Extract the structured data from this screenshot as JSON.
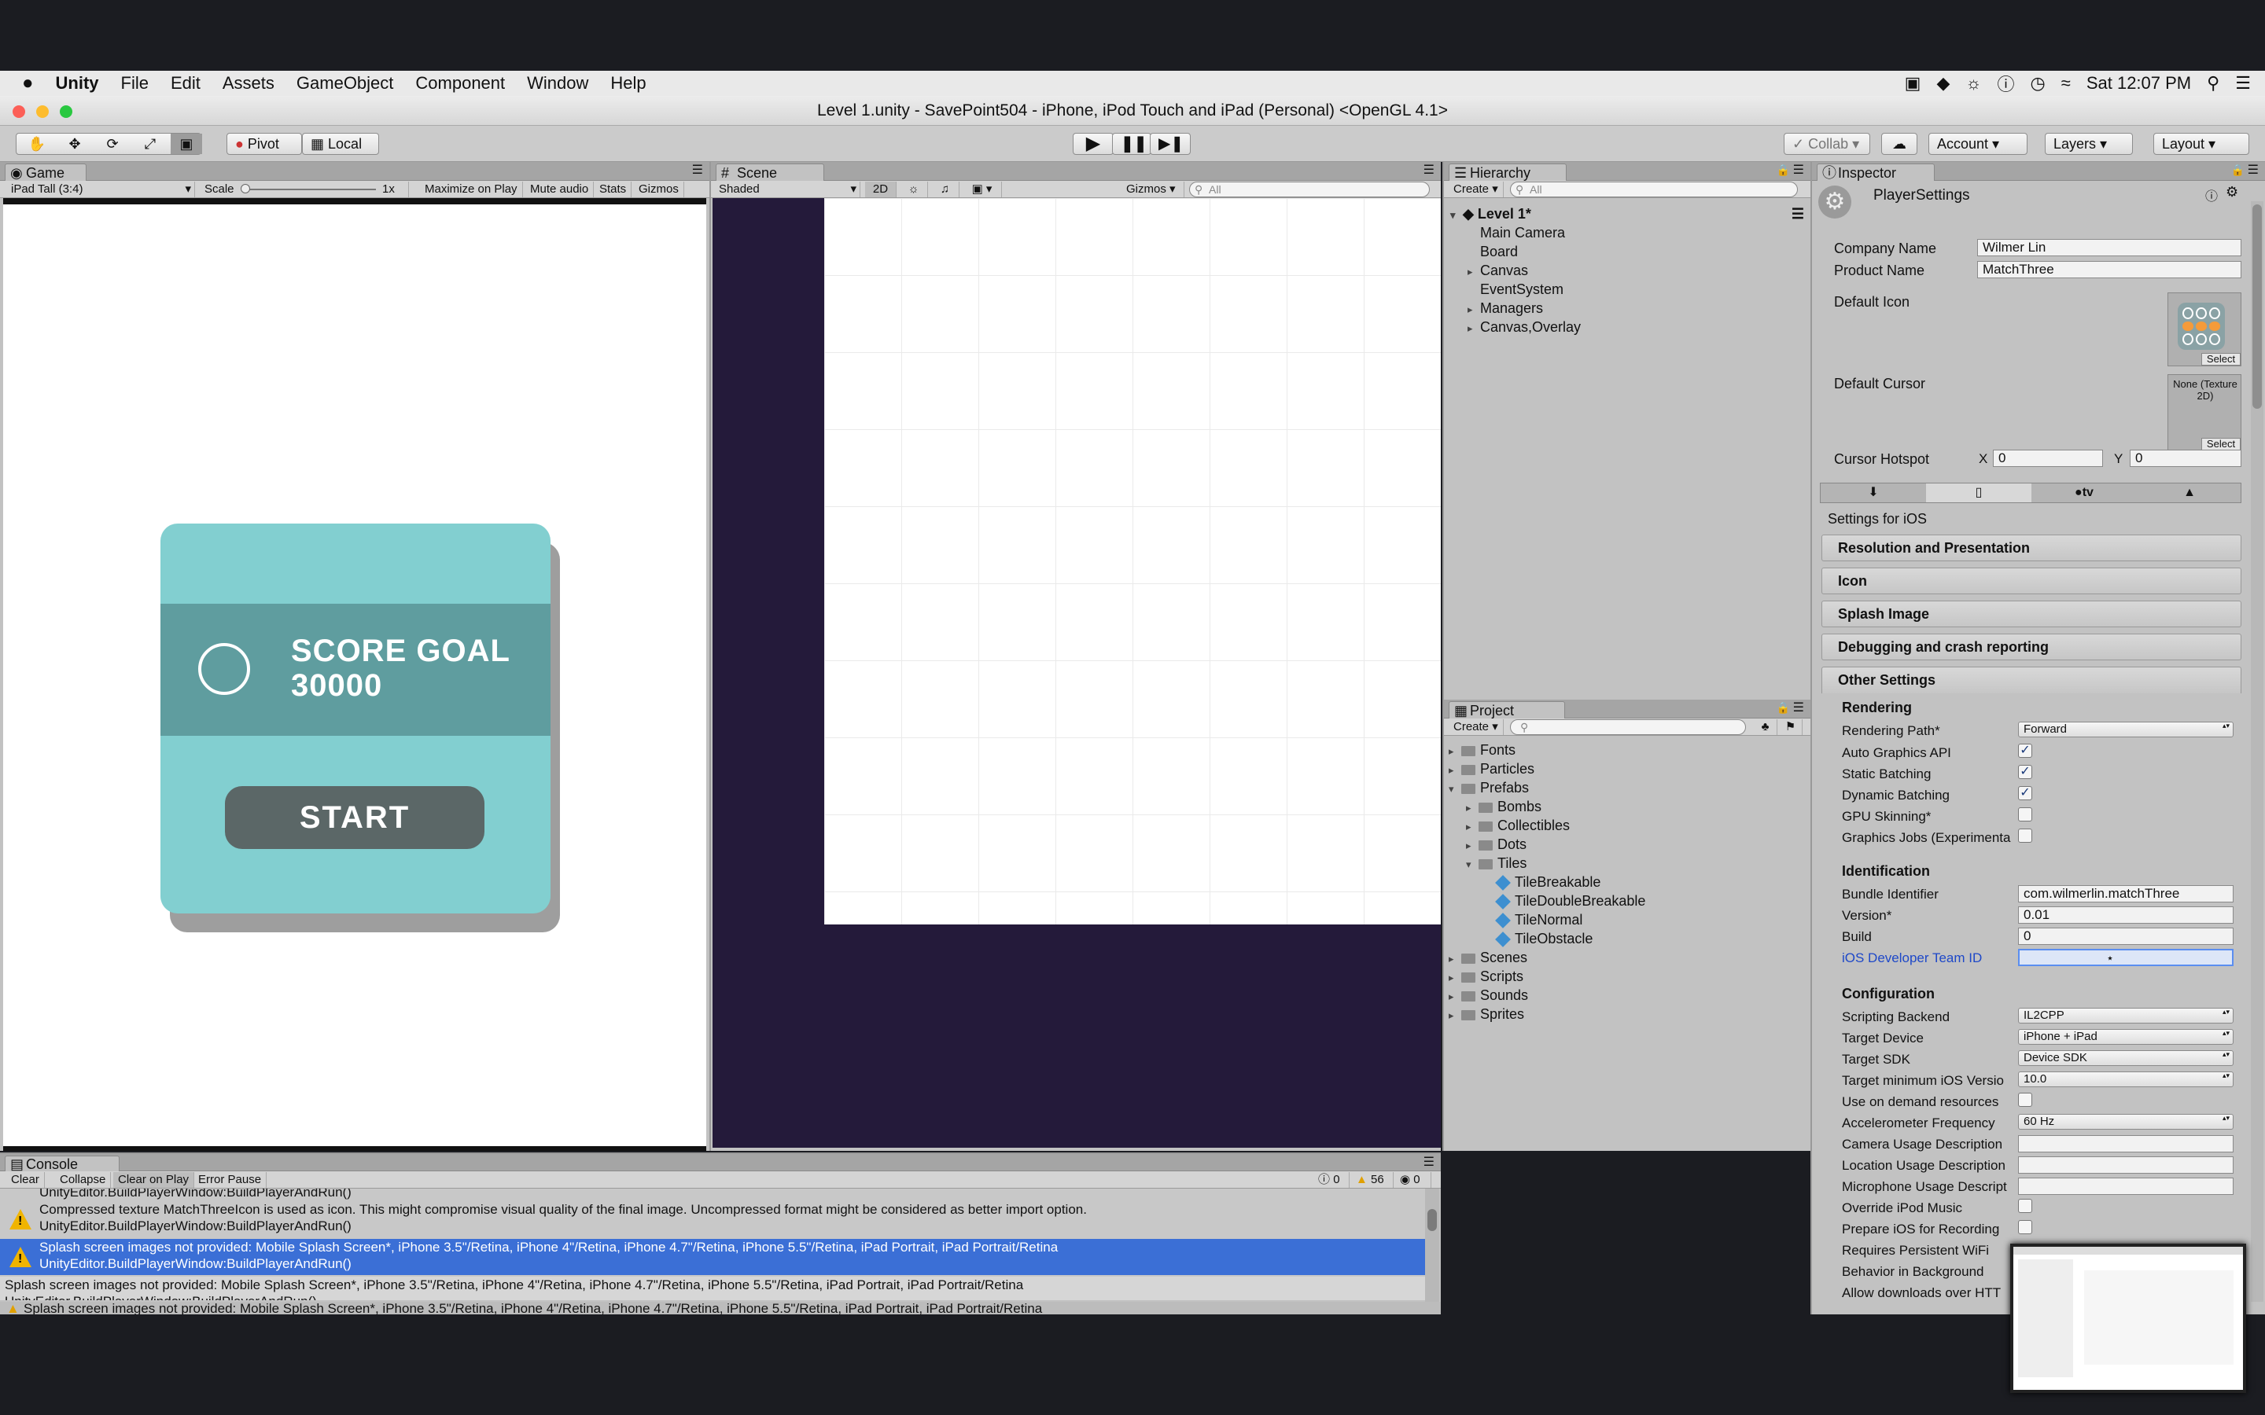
{
  "menubar": {
    "app": "Unity",
    "items": [
      "File",
      "Edit",
      "Assets",
      "GameObject",
      "Component",
      "Window",
      "Help"
    ],
    "clock": "Sat 12:07 PM"
  },
  "window": {
    "title": "Level 1.unity - SavePoint504 - iPhone, iPod Touch and iPad (Personal) <OpenGL 4.1>"
  },
  "toolbar": {
    "pivot": "Pivot",
    "local": "Local",
    "collab": "Collab",
    "account": "Account",
    "layers": "Layers",
    "layout": "Layout"
  },
  "game": {
    "tab": "Game",
    "resolution": "iPad Tall (3:4)",
    "scale_label": "Scale",
    "scale_value": "1x",
    "maximize": "Maximize on Play",
    "mute": "Mute audio",
    "stats": "Stats",
    "gizmos": "Gizmos",
    "card": {
      "score_line1": "SCORE GOAL",
      "score_line2": "30000",
      "start": "START"
    }
  },
  "scene": {
    "tab": "Scene",
    "shading": "Shaded",
    "mode2d": "2D",
    "gizmos": "Gizmos",
    "search_placeholder": "All"
  },
  "hierarchy": {
    "tab": "Hierarchy",
    "create": "Create",
    "search_placeholder": "All",
    "scene": "Level 1*",
    "items": [
      "Main Camera",
      "Board",
      "Canvas",
      "EventSystem",
      "Managers",
      "Canvas,Overlay"
    ]
  },
  "project": {
    "tab": "Project",
    "create": "Create",
    "items": [
      "Fonts",
      "Particles",
      "Prefabs",
      "Bombs",
      "Collectibles",
      "Dots",
      "Tiles",
      "TileBreakable",
      "TileDoubleBreakable",
      "TileNormal",
      "TileObstacle",
      "Scenes",
      "Scripts",
      "Sounds",
      "Sprites"
    ]
  },
  "inspector": {
    "tab": "Inspector",
    "title": "PlayerSettings",
    "company_label": "Company Name",
    "company_value": "Wilmer Lin",
    "product_label": "Product Name",
    "product_value": "MatchThree",
    "default_icon": "Default Icon",
    "default_cursor": "Default Cursor",
    "cursor_none": "None (Texture 2D)",
    "select": "Select",
    "cursor_hotspot": "Cursor Hotspot",
    "x_label": "X",
    "x_value": "0",
    "y_label": "Y",
    "y_value": "0",
    "settings_for": "Settings for iOS",
    "sections": [
      "Resolution and Presentation",
      "Icon",
      "Splash Image",
      "Debugging and crash reporting"
    ],
    "other_settings": "Other Settings",
    "rendering": "Rendering",
    "rendering_path_label": "Rendering Path*",
    "rendering_path_value": "Forward",
    "auto_graphics": "Auto Graphics API",
    "static_batching": "Static Batching",
    "dynamic_batching": "Dynamic Batching",
    "gpu_skinning": "GPU Skinning*",
    "graphics_jobs": "Graphics Jobs (Experimenta",
    "identification": "Identification",
    "bundle_label": "Bundle Identifier",
    "bundle_value": "com.wilmerlin.matchThree",
    "version_label": "Version*",
    "version_value": "0.01",
    "build_label": "Build",
    "build_value": "0",
    "team_label": "iOS Developer Team ID",
    "configuration": "Configuration",
    "scripting_label": "Scripting Backend",
    "scripting_value": "IL2CPP",
    "target_device_label": "Target Device",
    "target_device_value": "iPhone + iPad",
    "target_sdk_label": "Target SDK",
    "target_sdk_value": "Device SDK",
    "min_ios_label": "Target minimum iOS Versio",
    "min_ios_value": "10.0",
    "on_demand": "Use on demand resources",
    "accel_label": "Accelerometer Frequency",
    "accel_value": "60 Hz",
    "camera_usage": "Camera Usage Description",
    "location_usage": "Location Usage Description",
    "mic_usage": "Microphone Usage Descript",
    "override_ipod": "Override iPod Music",
    "prepare_ios": "Prepare iOS for Recording",
    "persistent_wifi": "Requires Persistent WiFi",
    "behavior_bg": "Behavior in Background",
    "allow_downloads": "Allow downloads over HTT"
  },
  "console": {
    "tab": "Console",
    "clear": "Clear",
    "collapse": "Collapse",
    "clear_on_play": "Clear on Play",
    "error_pause": "Error Pause",
    "count_info": "0",
    "count_warn": "56",
    "count_error": "0",
    "partial_line": "UnityEditor.BuildPlayerWindow:BuildPlayerAndRun()",
    "msg1_line1": "Compressed texture MatchThreeIcon is used as icon. This might compromise visual quality of the final image. Uncompressed format might be considered as better import option.",
    "msg1_line2": "UnityEditor.BuildPlayerWindow:BuildPlayerAndRun()",
    "msg2_line1": "Splash screen images not provided: Mobile Splash Screen*, iPhone 3.5\"/Retina, iPhone 4\"/Retina, iPhone 4.7\"/Retina, iPhone 5.5\"/Retina, iPad Portrait, iPad Portrait/Retina",
    "msg2_line2": "UnityEditor.BuildPlayerWindow:BuildPlayerAndRun()",
    "detail_line1": "Splash screen images not provided: Mobile Splash Screen*, iPhone 3.5\"/Retina, iPhone 4\"/Retina, iPhone 4.7\"/Retina, iPhone 5.5\"/Retina, iPad Portrait, iPad Portrait/Retina",
    "detail_line2": "UnityEditor.BuildPlayerWindow:BuildPlayerAndRun()",
    "status": "Splash screen images not provided: Mobile Splash Screen*, iPhone 3.5\"/Retina, iPhone 4\"/Retina, iPhone 4.7\"/Retina, iPhone 5.5\"/Retina, iPad Portrait, iPad Portrait/Retina"
  },
  "colors": {
    "card": "#82cfd0",
    "scene_bg": "#241a3a",
    "selection": "#3b6fd6"
  }
}
